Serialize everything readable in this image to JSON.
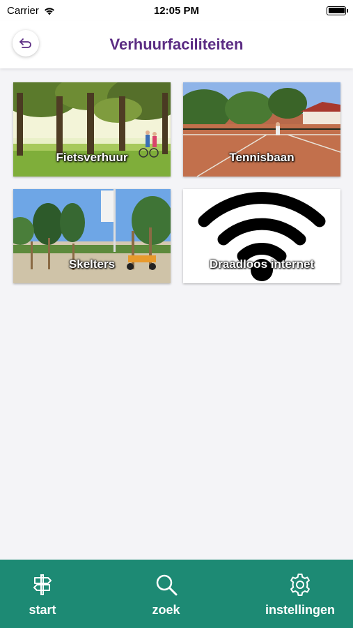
{
  "status_bar": {
    "carrier": "Carrier",
    "time": "12:05 PM"
  },
  "header": {
    "title": "Verhuurfaciliteiten",
    "back_icon": "back-arrow-icon"
  },
  "tiles": [
    {
      "label": "Fietsverhuur",
      "image": "cyclists-on-tree-lined-path"
    },
    {
      "label": "Tennisbaan",
      "image": "clay-tennis-court"
    },
    {
      "label": "Skelters",
      "image": "playground-with-go-karts"
    },
    {
      "label": "Draadloos internet",
      "image": "wifi-icon"
    }
  ],
  "tab_bar": {
    "accent_color": "#1d8a74",
    "items": [
      {
        "label": "start",
        "icon": "signpost-icon"
      },
      {
        "label": "zoek",
        "icon": "search-icon"
      },
      {
        "label": "instellingen",
        "icon": "gear-icon"
      }
    ]
  }
}
